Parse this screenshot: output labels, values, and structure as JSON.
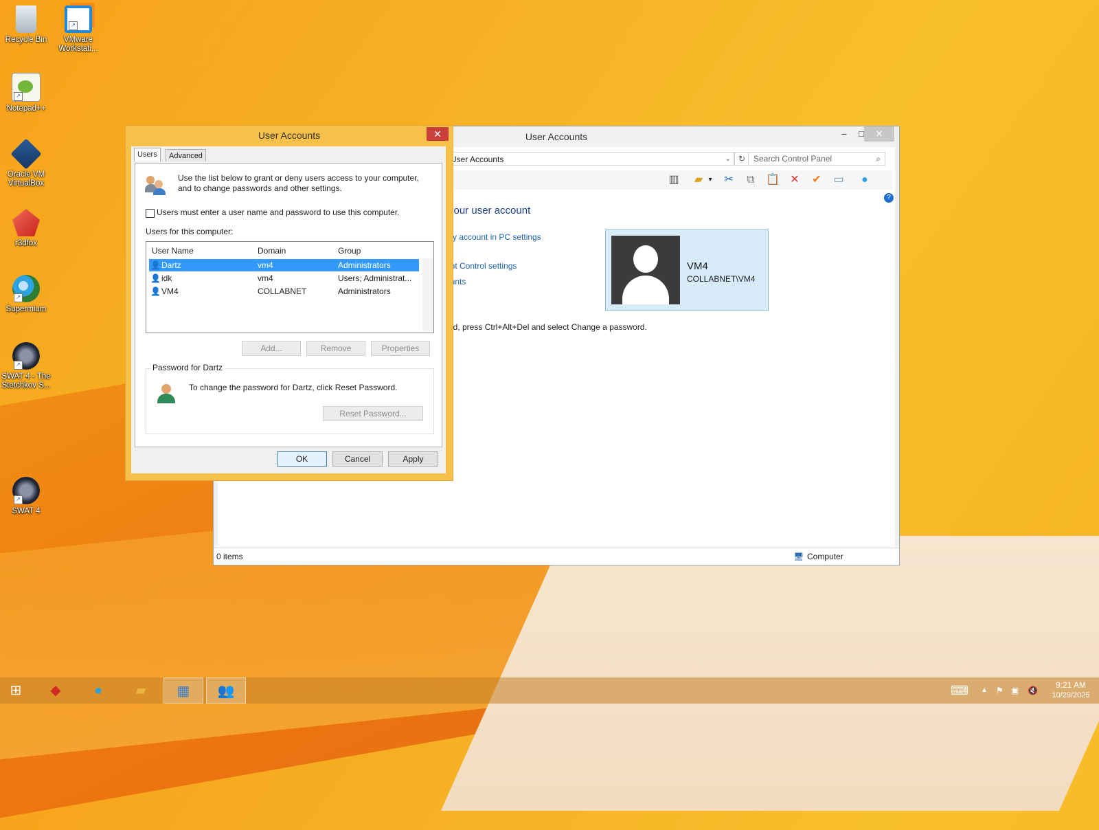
{
  "desktop_icons": [
    {
      "label": "Recycle Bin",
      "icon": "recycle-bin-icon"
    },
    {
      "label": "VMware Workstati...",
      "icon": "vmware-icon"
    },
    {
      "label": "Notepad++",
      "icon": "notepadpp-icon"
    },
    {
      "label": "Oracle VM VirtualBox",
      "icon": "virtualbox-icon"
    },
    {
      "label": "r3dfox",
      "icon": "r3dfox-icon"
    },
    {
      "label": "Supermium",
      "icon": "supermium-icon"
    },
    {
      "label": "SWAT 4 - The Stetchkov S...",
      "icon": "swat4-expansion-icon"
    },
    {
      "label": "SWAT 4",
      "icon": "swat4-icon"
    }
  ],
  "control_panel": {
    "title": "User Accounts",
    "address": "User Accounts",
    "search_placeholder": "Search Control Panel",
    "heading": "your user account",
    "links": [
      "my account in PC settings",
      "unt Control settings",
      "ounts"
    ],
    "password_hint": "ord, press Ctrl+Alt+Del and select Change a password.",
    "user_card": {
      "name": "VM4",
      "account": "COLLABNET\\VM4"
    },
    "status_items": "0 items",
    "status_zone": "Computer"
  },
  "dialog": {
    "title": "User Accounts",
    "tabs": [
      "Users",
      "Advanced"
    ],
    "intro": "Use the list below to grant or deny users access to your computer, and to change passwords and other settings.",
    "checkbox_label": "Users must enter a user name and password to use this computer.",
    "users_label": "Users for this computer:",
    "columns": [
      "User Name",
      "Domain",
      "Group"
    ],
    "rows": [
      {
        "name": "Dartz",
        "domain": "vm4",
        "group": "Administrators"
      },
      {
        "name": "idk",
        "domain": "vm4",
        "group": "Users; Administrat..."
      },
      {
        "name": "VM4",
        "domain": "COLLABNET",
        "group": "Administrators"
      }
    ],
    "add_label": "Add...",
    "remove_label": "Remove",
    "properties_label": "Properties",
    "password_group_label": "Password for Dartz",
    "password_text": "To change the password for Dartz, click Reset Password.",
    "reset_label": "Reset Password...",
    "ok_label": "OK",
    "cancel_label": "Cancel",
    "apply_label": "Apply"
  },
  "taskbar": {
    "time": "9:21 AM",
    "date": "10/29/2025"
  }
}
